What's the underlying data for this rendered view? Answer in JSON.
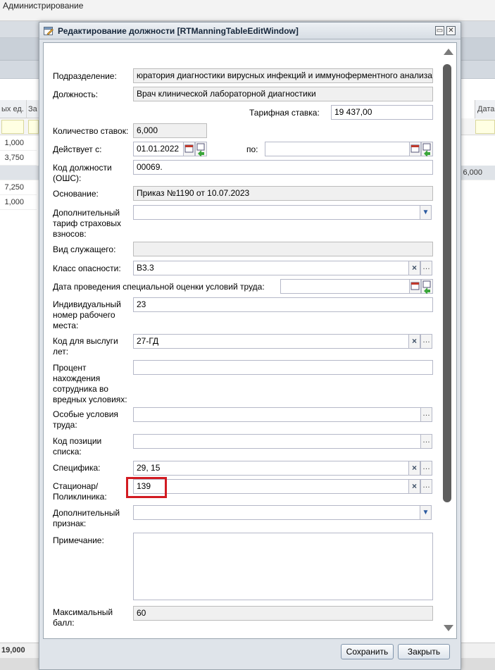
{
  "app": {
    "title": "Администрирование",
    "grid_headers": [
      "ых ед.",
      "За"
    ],
    "grid_header_right": "Дата",
    "grid_values": [
      "1,000",
      "3,750",
      "6,000",
      "7,250",
      "1,000"
    ],
    "grid_total": "19,000"
  },
  "window": {
    "title": "Редактирование должности [RTManningTableEditWindow]"
  },
  "form": {
    "podrazdelenie": {
      "label": "Подразделение:",
      "value": "юратория диагностики вирусных инфекций и иммуноферментного анализа"
    },
    "dolzhnost": {
      "label": "Должность:",
      "value": "Врач клинической лабораторной диагностики"
    },
    "tarif": {
      "label": "Тарифная ставка:",
      "value": "19 437,00"
    },
    "kol_stavok": {
      "label": "Количество ставок:",
      "value": "6,000"
    },
    "deystvuet": {
      "label": "Действует с:",
      "value": "01.01.2022"
    },
    "po": {
      "label": "по:",
      "value": ""
    },
    "kod_dolzhnosti": {
      "label": "Код должности (ОШС):",
      "value": "00069."
    },
    "osnovanie": {
      "label": "Основание:",
      "value": "Приказ №1190 от 10.07.2023"
    },
    "dop_tarif": {
      "label": "Дополнительный тариф страховых взносов:",
      "value": ""
    },
    "vid_sluzh": {
      "label": "Вид служащего:",
      "value": ""
    },
    "klass_opasnosti": {
      "label": "Класс опасности:",
      "value": "В3.3"
    },
    "data_spec_ocenki": {
      "label": "Дата проведения специальной оценки условий труда:",
      "value": ""
    },
    "ind_nomer": {
      "label": "Индивидуальный номер рабочего места:",
      "value": "23"
    },
    "kod_vysluga": {
      "label": "Код для выслуги лет:",
      "value": "27-ГД"
    },
    "procent": {
      "label": "Процент нахождения сотрудника во вредных условиях:",
      "value": ""
    },
    "osobye_usloviya": {
      "label": "Особые условия труда:",
      "value": ""
    },
    "kod_pozicii": {
      "label": "Код позиции списка:",
      "value": ""
    },
    "specifika": {
      "label": "Специфика:",
      "value": "29, 15"
    },
    "stacionar": {
      "label": "Стационар/ Поликлиника:",
      "value": "139"
    },
    "dop_priznak": {
      "label": "Дополнительный признак:",
      "value": ""
    },
    "primechanie": {
      "label": "Примечание:",
      "value": ""
    },
    "max_ball": {
      "label": "Максимальный балл:",
      "value": "60"
    }
  },
  "buttons": {
    "save": "Сохранить",
    "close": "Закрыть"
  },
  "icons": {
    "add": "add-icon",
    "edit": "edit-icon",
    "delete": "delete-icon",
    "refresh": "refresh-icon",
    "more": "more-icon"
  },
  "colors": {
    "highlight": "#d21b22",
    "window_header": "#15263a"
  }
}
